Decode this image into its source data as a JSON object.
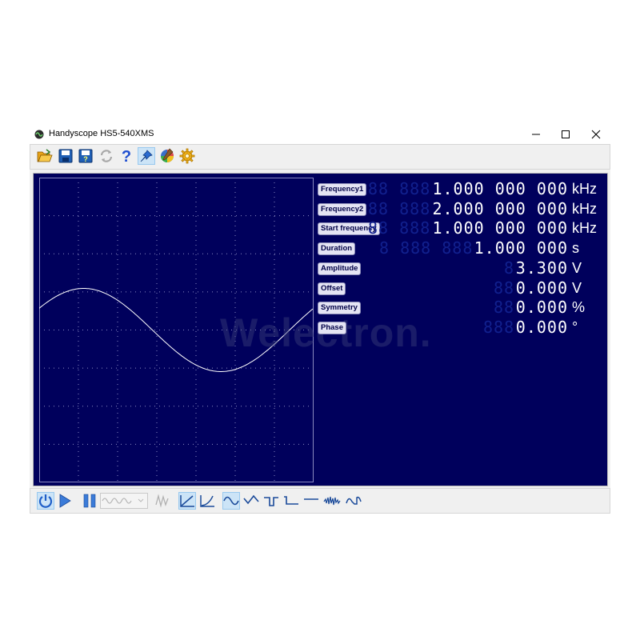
{
  "window": {
    "title": "Handyscope HS5-540XMS"
  },
  "toolbar": {
    "icons": [
      "open-folder-icon",
      "save-icon",
      "save-as-icon",
      "refresh-icon",
      "help-icon",
      "pin-icon",
      "color-icon",
      "settings-icon"
    ]
  },
  "parameters": [
    {
      "label": "Frequency1",
      "ghost": "88 888",
      "value": "1.000 000 000",
      "unit": "kHz"
    },
    {
      "label": "Frequency2",
      "ghost": "88 888",
      "value": "2.000 000 000",
      "unit": "kHz"
    },
    {
      "label": "Start frequency",
      "ghost": "88 888",
      "value": "1.000 000 000",
      "unit": "kHz"
    },
    {
      "label": "Duration",
      "ghost": "8 888 888",
      "value": "1.000 000",
      "unit": "s"
    },
    {
      "label": "Amplitude",
      "ghost": "8",
      "value": "3.300",
      "unit": "V"
    },
    {
      "label": "Offset",
      "ghost": "88",
      "value": "0.000",
      "unit": "V"
    },
    {
      "label": "Symmetry",
      "ghost": "88",
      "value": "0.000",
      "unit": "%"
    },
    {
      "label": "Phase",
      "ghost": "888",
      "value": "0.000",
      "unit": "°"
    }
  ],
  "watermark": "Welectron.",
  "colors": {
    "panel": "#00005c",
    "trace": "#ffffff",
    "grid": "#8a8ac0",
    "ghost_digits": "#11208e"
  },
  "bottombar": {
    "icons": [
      "power-icon",
      "play-icon",
      "pause-icon",
      "waveform-combo",
      "arbitrary-wave-icon",
      "linear-sweep-icon",
      "log-sweep-icon",
      "sine-wave-icon",
      "triangle-wave-icon",
      "square-wave-icon",
      "pulse-wave-icon",
      "dc-icon",
      "noise-icon",
      "arbitrary-icon"
    ]
  }
}
